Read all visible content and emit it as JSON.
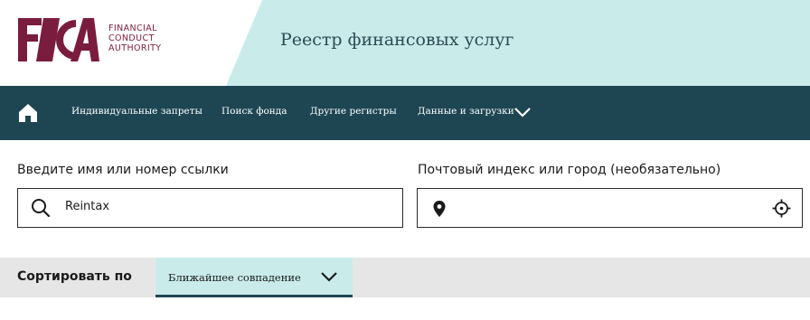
{
  "header": {
    "logo": {
      "mark": "FCA",
      "lines": [
        "FINANCIAL",
        "CONDUCT",
        "AUTHORITY"
      ]
    },
    "title": "Реестр финансовых услуг"
  },
  "nav": {
    "home_icon": "home-icon",
    "items": [
      {
        "label": "Индивидуальные запреты"
      },
      {
        "label": "Поиск фонда"
      },
      {
        "label": "Другие регистры"
      },
      {
        "label": "Данные и загрузки"
      }
    ],
    "dropdown_icon": "chevron-down-icon"
  },
  "search": {
    "name_label": "Введите имя или номер ссылки",
    "name_value": "Reintax",
    "location_label": "Почтовый индекс или город (необязательно)",
    "location_value": "",
    "icons": [
      "search-icon",
      "location-pin-icon",
      "crosshair-icon"
    ]
  },
  "sort": {
    "label": "Сортировать по",
    "selected": "Ближайшее совпадение"
  },
  "colors": {
    "brand": "#7a1c3e",
    "nav_bg": "#1e4652",
    "accent_band": "#c9ecea",
    "sort_bar_bg": "#e6e6e6"
  }
}
